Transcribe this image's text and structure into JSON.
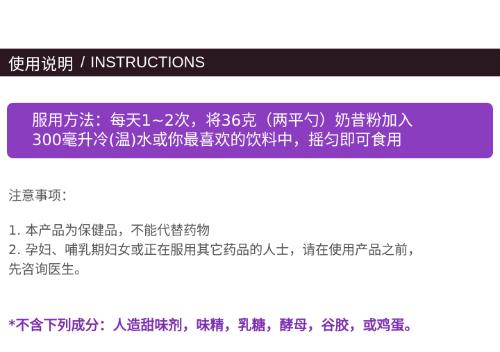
{
  "header": {
    "title_cn": "使用说明",
    "separator": "/",
    "title_en": "INSTRUCTIONS"
  },
  "method": {
    "lines": [
      "服用方法：每天1~2次，将36克（两平勺）奶昔粉加入",
      "300毫升冷(温)水或你最喜欢的饮料中，摇匀即可食用"
    ]
  },
  "notes": {
    "heading": "注意事项：",
    "items": [
      "1. 本产品为保健品，不能代替药物",
      "2. 孕妇、哺乳期妇女或正在服用其它药品的人士，请在使用产品之前，",
      "先咨询医生。"
    ]
  },
  "excluded": {
    "text": "*不含下列成分：人造甜味剂，味精，乳糖，酵母，谷胶，或鸡蛋。"
  },
  "colors": {
    "header_bg": "#2a1720",
    "accent_purple": "#8a3dbf",
    "excluded_text": "#7d2fb0",
    "body_text": "#555555"
  }
}
